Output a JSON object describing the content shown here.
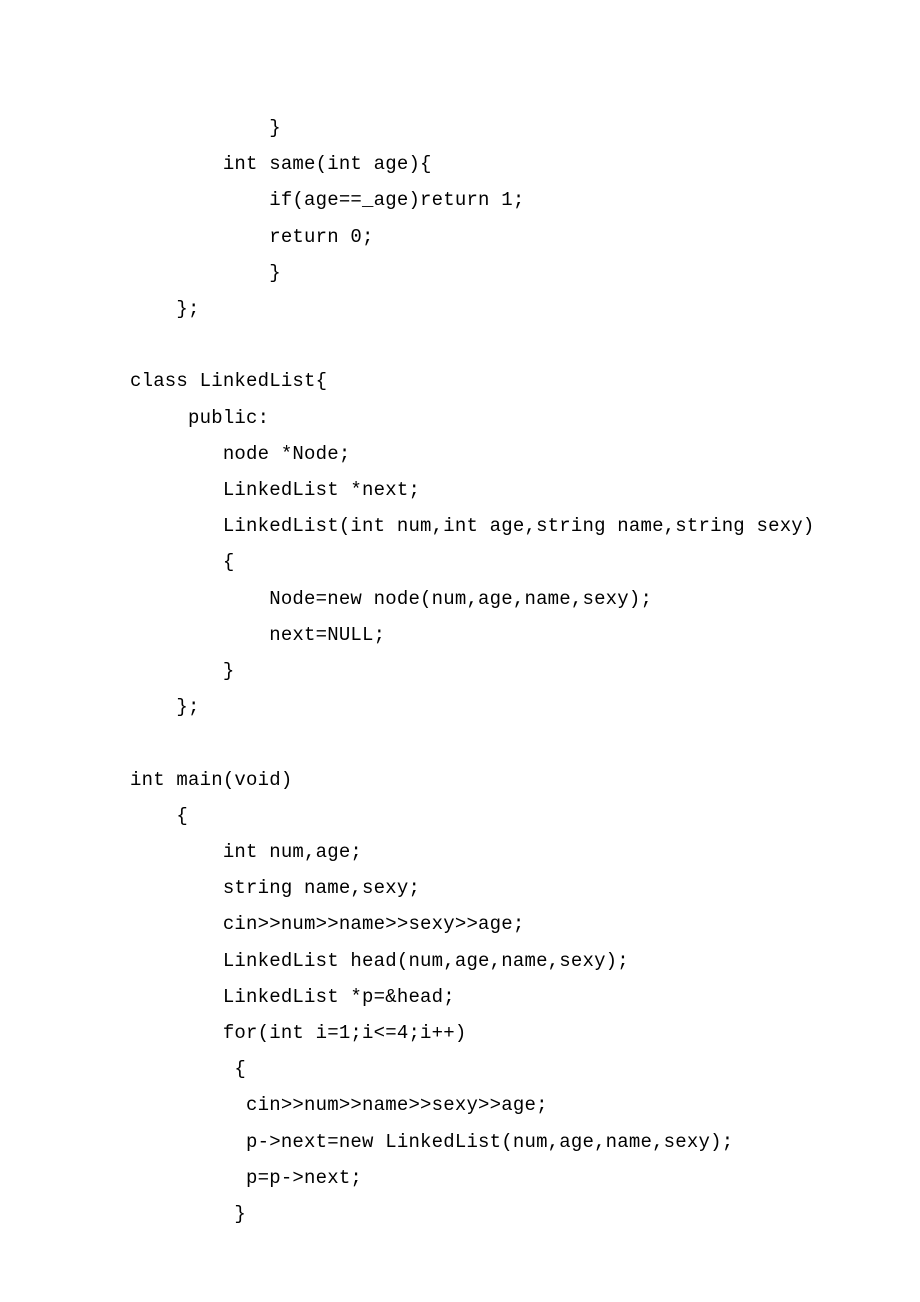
{
  "code": {
    "lines": [
      "            }",
      "        int same(int age){",
      "            if(age==_age)return 1;",
      "            return 0;",
      "            }",
      "    };",
      "",
      "class LinkedList{",
      "     public:",
      "        node *Node;",
      "        LinkedList *next;",
      "        LinkedList(int num,int age,string name,string sexy)",
      "        {",
      "            Node=new node(num,age,name,sexy);",
      "            next=NULL;",
      "        }",
      "    };",
      "",
      "int main(void)",
      "    {",
      "        int num,age;",
      "        string name,sexy;",
      "        cin>>num>>name>>sexy>>age;",
      "        LinkedList head(num,age,name,sexy);",
      "        LinkedList *p=&head;",
      "        for(int i=1;i<=4;i++)",
      "         {",
      "          cin>>num>>name>>sexy>>age;",
      "          p->next=new LinkedList(num,age,name,sexy);",
      "          p=p->next;",
      "         }"
    ]
  }
}
